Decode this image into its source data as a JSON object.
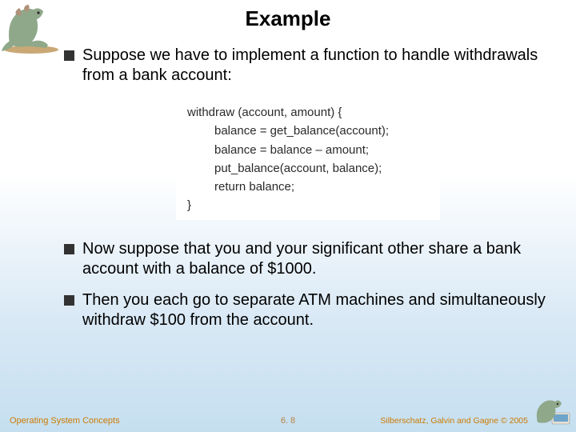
{
  "title": "Example",
  "bullets": [
    "Suppose we have to implement a function to handle withdrawals from a bank account:",
    "Now suppose that you and your significant other share a bank account with a balance of $1000.",
    "Then you each go to separate ATM machines and simultaneously withdraw $100 from the account."
  ],
  "code": {
    "l1": "withdraw (account, amount) {",
    "l2": "balance = get_balance(account);",
    "l3": "balance = balance – amount;",
    "l4": "put_balance(account, balance);",
    "l5": "return balance;",
    "l6": "}"
  },
  "footer": {
    "left": "Operating System Concepts",
    "center": "6. 8",
    "right": "Silberschatz, Galvin and Gagne © 2005"
  }
}
